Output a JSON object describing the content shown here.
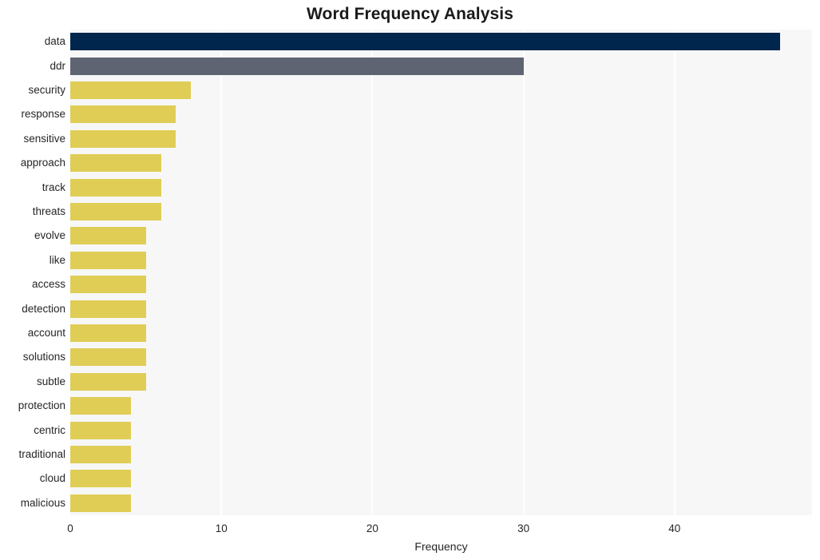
{
  "chart_data": {
    "type": "bar",
    "orientation": "horizontal",
    "title": "Word Frequency Analysis",
    "xlabel": "Frequency",
    "ylabel": "",
    "xlim": [
      0,
      49.1
    ],
    "xticks": [
      0,
      10,
      20,
      30,
      40
    ],
    "xtick_labels": [
      "0",
      "10",
      "20",
      "30",
      "40"
    ],
    "grid": "vertical-white-on-light-gray",
    "legend": "none",
    "categories": [
      "data",
      "ddr",
      "security",
      "response",
      "sensitive",
      "approach",
      "track",
      "threats",
      "evolve",
      "like",
      "access",
      "detection",
      "account",
      "solutions",
      "subtle",
      "protection",
      "centric",
      "traditional",
      "cloud",
      "malicious"
    ],
    "values": [
      47,
      30,
      8,
      7,
      7,
      6,
      6,
      6,
      5,
      5,
      5,
      5,
      5,
      5,
      5,
      4,
      4,
      4,
      4,
      4
    ],
    "bar_colors": [
      "#00264d",
      "#5f6472",
      "#dfcd56",
      "#dfcd56",
      "#dfcd56",
      "#dfcd56",
      "#dfcd56",
      "#dfcd56",
      "#dfcd56",
      "#dfcd56",
      "#dfcd56",
      "#dfcd56",
      "#dfcd56",
      "#dfcd56",
      "#dfcd56",
      "#dfcd56",
      "#dfcd56",
      "#dfcd56",
      "#dfcd56",
      "#dfcd56"
    ],
    "colors": {
      "highest": "#00264d",
      "second": "#5f6472",
      "rest": "#dfcd56",
      "plot_background": "#f7f7f7",
      "figure_background": "#ffffff",
      "gridline": "#ffffff",
      "text": "#262626",
      "title_text": "#1a1a1a"
    }
  }
}
